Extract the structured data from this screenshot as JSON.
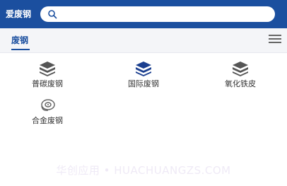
{
  "header": {
    "app_title": "爱废钢",
    "search_placeholder": "",
    "background_color": "#1b4f9f"
  },
  "tabs": {
    "active_label": "废钢",
    "menu_icon": "hamburger-menu-icon"
  },
  "categories": [
    {
      "label": "普碳废钢",
      "icon": "steel-stack-icon",
      "icon_color": "#555555"
    },
    {
      "label": "国际废钢",
      "icon": "steel-stack-icon",
      "icon_color": "#1b3f8f"
    },
    {
      "label": "氧化铁皮",
      "icon": "steel-stack-icon",
      "icon_color": "#555555"
    },
    {
      "label": "合金废钢",
      "icon": "alloy-coil-icon",
      "icon_color": "#666666"
    }
  ],
  "watermark": "华创应用 • HUACHUANGZS.COM"
}
